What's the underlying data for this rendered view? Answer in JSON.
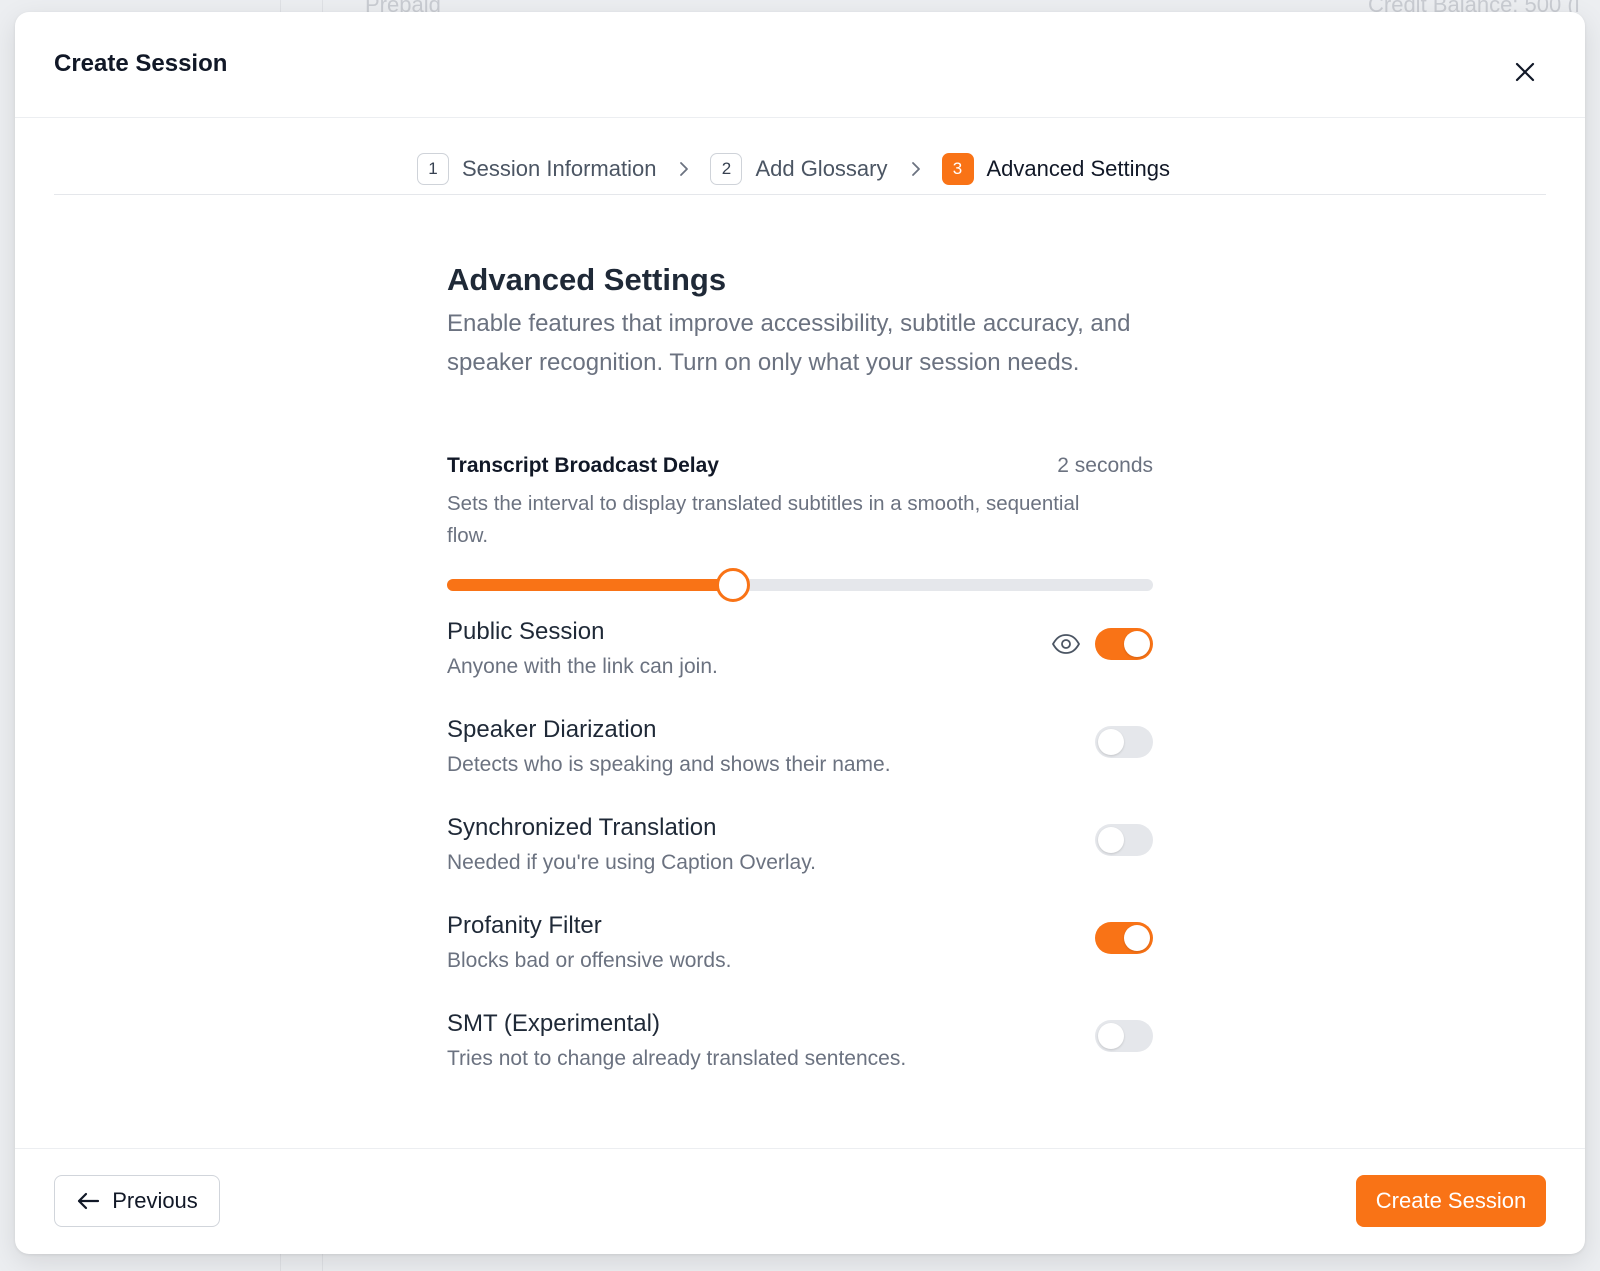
{
  "background": {
    "left_text": "Prepaid",
    "right_text": "Credit Balance: 500 (i"
  },
  "modal": {
    "title": "Create Session"
  },
  "stepper": {
    "steps": [
      {
        "number": "1",
        "label": "Session Information",
        "state": "completed"
      },
      {
        "number": "2",
        "label": "Add Glossary",
        "state": "completed"
      },
      {
        "number": "3",
        "label": "Advanced Settings",
        "state": "active"
      }
    ]
  },
  "section": {
    "title": "Advanced Settings",
    "description": "Enable features that improve accessibility, subtitle accuracy, and speaker recognition. Turn on only what your session needs."
  },
  "delay": {
    "title": "Transcript Broadcast Delay",
    "value_label": "2 seconds",
    "description": "Sets the interval to display translated subtitles in a smooth, sequential flow.",
    "fraction": 0.405
  },
  "settings": [
    {
      "title": "Public Session",
      "description": "Anyone with the link can join.",
      "on": true,
      "icon": "eye-icon"
    },
    {
      "title": "Speaker Diarization",
      "description": "Detects who is speaking and shows their name.",
      "on": false
    },
    {
      "title": "Synchronized Translation",
      "description": "Needed if you're using Caption Overlay.",
      "on": false
    },
    {
      "title": "Profanity Filter",
      "description": "Blocks bad or offensive words.",
      "on": true
    },
    {
      "title": "SMT (Experimental)",
      "description": "Tries not to change already translated sentences.",
      "on": false
    }
  ],
  "footer": {
    "previous_label": "Previous",
    "create_label": "Create Session"
  },
  "colors": {
    "accent": "#f97316",
    "toggle_off": "#e5e7eb"
  }
}
